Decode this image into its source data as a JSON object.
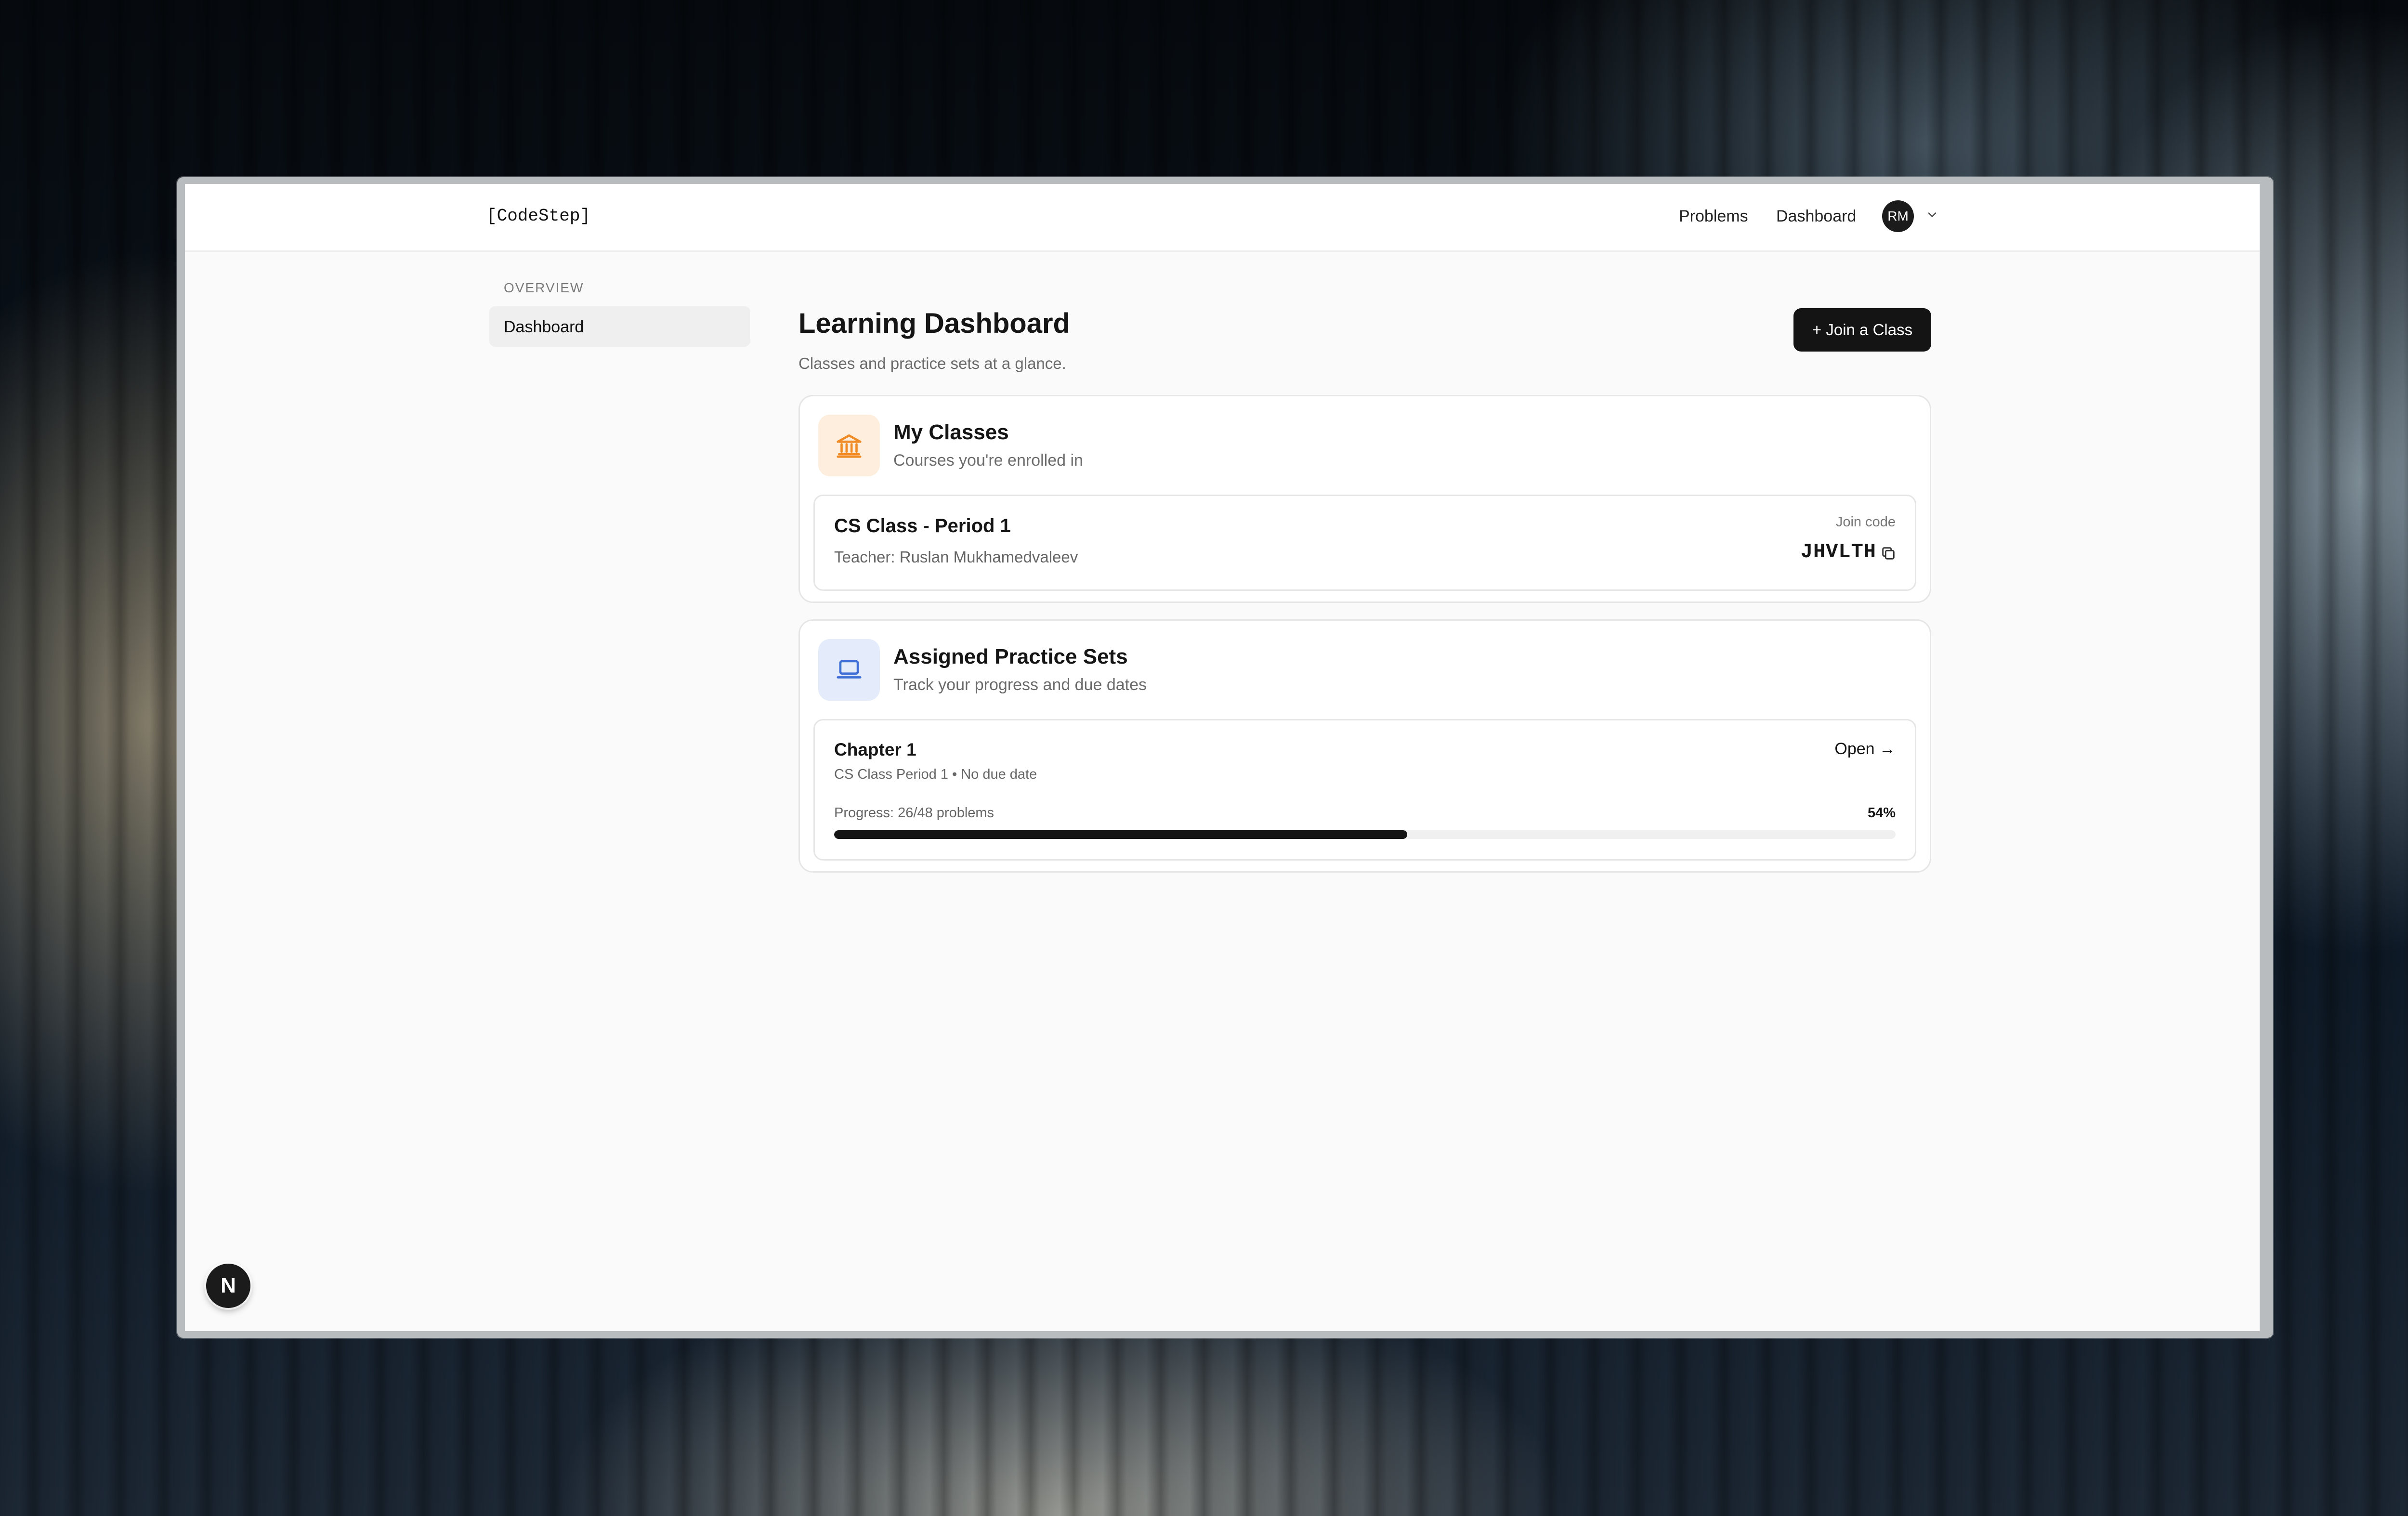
{
  "app": {
    "logo": "[CodeStep]"
  },
  "topnav": {
    "links": [
      "Problems",
      "Dashboard"
    ],
    "avatar_initials": "RM",
    "icons": {
      "account_menu": "chevron-down-icon"
    }
  },
  "sidebar": {
    "section_title": "OVERVIEW",
    "items": [
      {
        "label": "Dashboard",
        "active": true
      }
    ]
  },
  "main": {
    "title": "Learning Dashboard",
    "subtitle": "Classes and practice sets at a glance.",
    "join_button": "+ Join a Class",
    "my_classes": {
      "title": "My Classes",
      "subtitle": "Courses you're enrolled in",
      "icon": "bank-building-icon",
      "icon_color": "#f08a24",
      "icon_bg": "#fdeedd",
      "classes": [
        {
          "name": "CS Class - Period 1",
          "teacher": "Teacher: Ruslan Mukhamedvaleev",
          "join_label": "Join code",
          "join_code": "JHVLTH"
        }
      ]
    },
    "practice_sets": {
      "title": "Assigned Practice Sets",
      "subtitle": "Track your progress and due dates",
      "icon": "laptop-icon",
      "icon_color": "#3f6fd6",
      "icon_bg": "#e4ecfb",
      "sets": [
        {
          "title": "Chapter 1",
          "meta": "CS Class Period 1 • No due date",
          "open_label": "Open →",
          "progress_label": "Progress: 26/48 problems",
          "progress_percent_text": "54%",
          "progress_fraction": 0.54
        }
      ]
    }
  },
  "dev_badge": {
    "letter": "N"
  }
}
